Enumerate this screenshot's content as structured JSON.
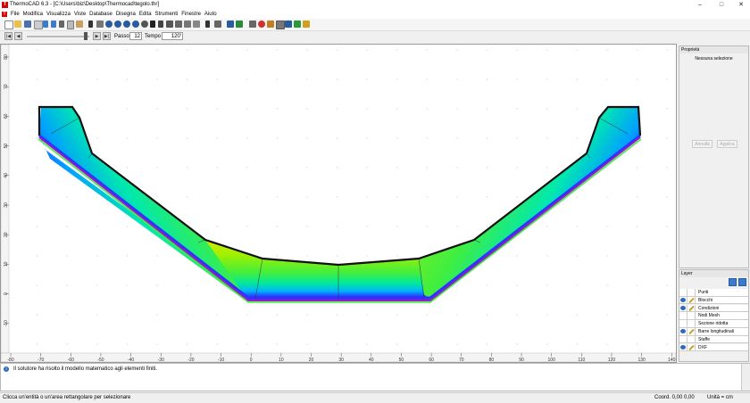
{
  "window": {
    "title": "ThermoCAD 6.3 - [C:\\Users\\biz\\Desktop\\Thermocad\\tegolo.thr]",
    "logo_text": "T"
  },
  "menu": [
    "File",
    "Modifica",
    "Visualizza",
    "Viste",
    "Database",
    "Disegna",
    "Edita",
    "Strumenti",
    "Finestre",
    "Aiuto"
  ],
  "playbar": {
    "passo_label": "Passo",
    "passo_value": "12",
    "tempo_label": "Tempo",
    "tempo_value": "120'"
  },
  "properties": {
    "title": "Proprietà",
    "selection": "Nessuna selezione",
    "apply_btn": "Annulla",
    "apply2_btn": "Applica"
  },
  "layer": {
    "title": "Layer",
    "rows": [
      {
        "name": "Punti",
        "visible": false,
        "editable": false
      },
      {
        "name": "Blocchi",
        "visible": true,
        "editable": true
      },
      {
        "name": "Condizioni",
        "visible": true,
        "editable": true
      },
      {
        "name": "Nodi Mesh",
        "visible": false,
        "editable": false
      },
      {
        "name": "Sezione ridotta",
        "visible": false,
        "editable": false
      },
      {
        "name": "Barre longitudinali",
        "visible": true,
        "editable": true
      },
      {
        "name": "Staffe",
        "visible": false,
        "editable": false
      },
      {
        "name": "DXF",
        "visible": true,
        "editable": true
      }
    ]
  },
  "message": "Il solutore ha risolto il modello matematico agli elementi finiti.",
  "status": {
    "hint": "Clicca un'entità o un'area rettangolare per selezionare",
    "coords": "Coord. 0,00 0,00",
    "units": "Unità = cm"
  },
  "axis": {
    "x_ticks": [
      "-80",
      "-70",
      "-60",
      "-50",
      "-40",
      "-30",
      "-20",
      "-10",
      "0",
      "10",
      "20",
      "30",
      "40",
      "50",
      "60",
      "70",
      "80",
      "90",
      "100",
      "110",
      "120",
      "130",
      "140"
    ],
    "y_ticks": [
      "80",
      "70",
      "60",
      "50",
      "40",
      "30",
      "20",
      "10",
      "0",
      "-10"
    ]
  }
}
